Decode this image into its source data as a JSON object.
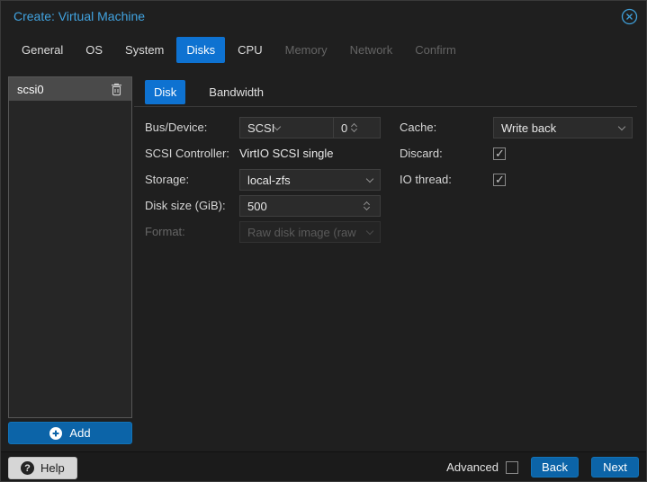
{
  "window": {
    "title": "Create: Virtual Machine",
    "close_icon": "circle-x"
  },
  "wizard_tabs": [
    {
      "label": "General",
      "state": "enabled"
    },
    {
      "label": "OS",
      "state": "enabled"
    },
    {
      "label": "System",
      "state": "enabled"
    },
    {
      "label": "Disks",
      "state": "active"
    },
    {
      "label": "CPU",
      "state": "enabled"
    },
    {
      "label": "Memory",
      "state": "disabled"
    },
    {
      "label": "Network",
      "state": "disabled"
    },
    {
      "label": "Confirm",
      "state": "disabled"
    }
  ],
  "sidebar": {
    "items": [
      {
        "label": "scsi0",
        "delete_icon": "trash"
      }
    ],
    "add_button": {
      "label": "Add",
      "icon": "plus-circle"
    }
  },
  "disk_panel": {
    "tabs": [
      {
        "label": "Disk",
        "state": "active"
      },
      {
        "label": "Bandwidth",
        "state": "enabled"
      }
    ],
    "fields": {
      "bus_device": {
        "label": "Bus/Device:",
        "value": "SCSI",
        "number": "0"
      },
      "scsi_controller": {
        "label": "SCSI Controller:",
        "value": "VirtIO SCSI single"
      },
      "storage": {
        "label": "Storage:",
        "value": "local-zfs"
      },
      "disk_size": {
        "label": "Disk size (GiB):",
        "value": "500"
      },
      "format": {
        "label": "Format:",
        "value": "Raw disk image (raw",
        "disabled": true
      },
      "cache": {
        "label": "Cache:",
        "value": "Write back"
      },
      "discard": {
        "label": "Discard:",
        "checked": true
      },
      "io_thread": {
        "label": "IO thread:",
        "checked": true
      }
    }
  },
  "footer": {
    "help_button": {
      "label": "Help",
      "icon": "question-circle"
    },
    "advanced_label": "Advanced",
    "advanced_checked": false,
    "back_button": "Back",
    "next_button": "Next"
  },
  "colors": {
    "dialog_bg": "#1f1f1f",
    "title_blue": "#41a3e0",
    "tab_active_blue": "#0e72d1",
    "button_blue": "#0c64a8",
    "selected_item_bg": "#4a4a4a",
    "field_bg": "#2b2b2b",
    "help_button_bg": "#d6d6d6"
  }
}
